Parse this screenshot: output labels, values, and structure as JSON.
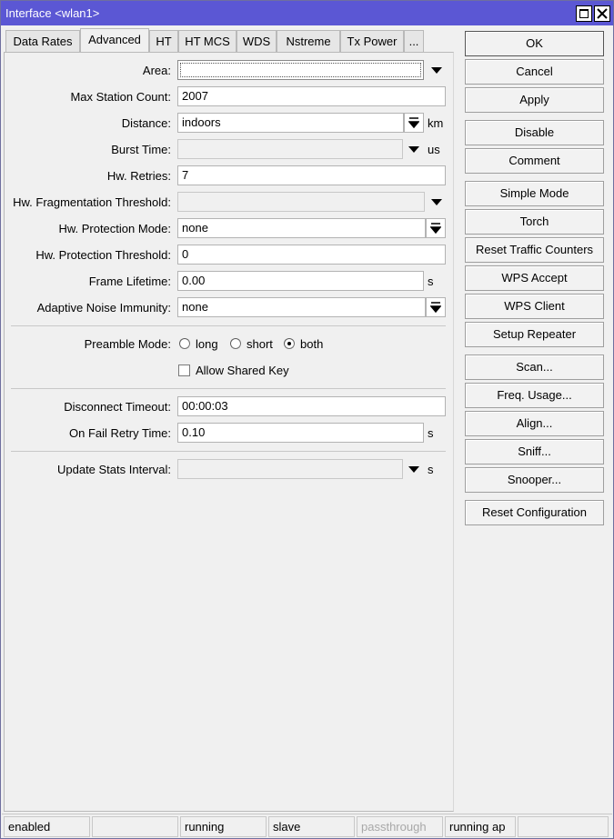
{
  "window": {
    "title": "Interface <wlan1>"
  },
  "tabs": [
    "Data Rates",
    "Advanced",
    "HT",
    "HT MCS",
    "WDS",
    "Nstreme",
    "Tx Power",
    "..."
  ],
  "form": {
    "area": {
      "label": "Area:",
      "value": ""
    },
    "max_station_count": {
      "label": "Max Station Count:",
      "value": "2007"
    },
    "distance": {
      "label": "Distance:",
      "value": "indoors",
      "unit": "km"
    },
    "burst_time": {
      "label": "Burst Time:",
      "value": "",
      "unit": "us"
    },
    "hw_retries": {
      "label": "Hw. Retries:",
      "value": "7"
    },
    "hw_frag_threshold": {
      "label": "Hw. Fragmentation Threshold:",
      "value": ""
    },
    "hw_protection_mode": {
      "label": "Hw. Protection Mode:",
      "value": "none"
    },
    "hw_protection_threshold": {
      "label": "Hw. Protection Threshold:",
      "value": "0"
    },
    "frame_lifetime": {
      "label": "Frame Lifetime:",
      "value": "0.00",
      "unit": "s"
    },
    "adaptive_noise_immunity": {
      "label": "Adaptive Noise Immunity:",
      "value": "none"
    },
    "preamble_mode": {
      "label": "Preamble Mode:",
      "options": [
        "long",
        "short",
        "both"
      ],
      "selected": "both"
    },
    "allow_shared_key": {
      "label": "Allow Shared Key",
      "checked": false
    },
    "disconnect_timeout": {
      "label": "Disconnect Timeout:",
      "value": "00:00:03"
    },
    "on_fail_retry_time": {
      "label": "On Fail Retry Time:",
      "value": "0.10",
      "unit": "s"
    },
    "update_stats_interval": {
      "label": "Update Stats Interval:",
      "value": "",
      "unit": "s"
    }
  },
  "buttons": {
    "ok": "OK",
    "cancel": "Cancel",
    "apply": "Apply",
    "disable": "Disable",
    "comment": "Comment",
    "simple_mode": "Simple Mode",
    "torch": "Torch",
    "reset_traffic_counters": "Reset Traffic Counters",
    "wps_accept": "WPS Accept",
    "wps_client": "WPS Client",
    "setup_repeater": "Setup Repeater",
    "scan": "Scan...",
    "freq_usage": "Freq. Usage...",
    "align": "Align...",
    "sniff": "Sniff...",
    "snooper": "Snooper...",
    "reset_configuration": "Reset Configuration"
  },
  "statusbar": [
    "enabled",
    "",
    "running",
    "slave",
    "passthrough",
    "running ap",
    ""
  ]
}
